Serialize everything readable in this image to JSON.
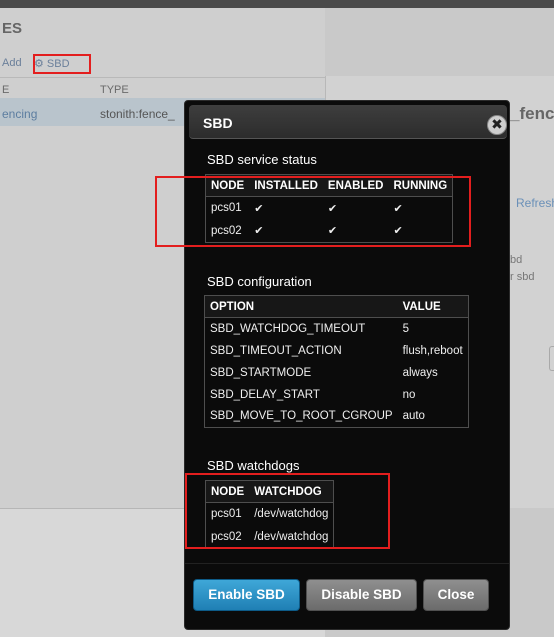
{
  "background": {
    "section_title": "ES",
    "add_label": "Add",
    "sbd_button_label": "⚙ SBD",
    "col_name": "E",
    "col_type": "TYPE",
    "row_name": "encing",
    "row_type": "stonith:fence_",
    "detail_title": "_fenc",
    "refresh_link": "Refresh",
    "detail_line1": "bd",
    "detail_line2": "r sbd"
  },
  "dialog": {
    "title": "SBD",
    "close_glyph": "✖",
    "status": {
      "title": "SBD service status",
      "headers": [
        "NODE",
        "INSTALLED",
        "ENABLED",
        "RUNNING"
      ],
      "rows": [
        {
          "node": "pcs01",
          "installed": "✔",
          "enabled": "✔",
          "running": "✔"
        },
        {
          "node": "pcs02",
          "installed": "✔",
          "enabled": "✔",
          "running": "✔"
        }
      ]
    },
    "config": {
      "title": "SBD configuration",
      "headers": [
        "OPTION",
        "VALUE"
      ],
      "rows": [
        {
          "option": "SBD_WATCHDOG_TIMEOUT",
          "value": "5"
        },
        {
          "option": "SBD_TIMEOUT_ACTION",
          "value": "flush,reboot"
        },
        {
          "option": "SBD_STARTMODE",
          "value": "always"
        },
        {
          "option": "SBD_DELAY_START",
          "value": "no"
        },
        {
          "option": "SBD_MOVE_TO_ROOT_CGROUP",
          "value": "auto"
        }
      ]
    },
    "watchdogs": {
      "title": "SBD watchdogs",
      "headers": [
        "NODE",
        "WATCHDOG"
      ],
      "rows": [
        {
          "node": "pcs01",
          "watchdog": "/dev/watchdog"
        },
        {
          "node": "pcs02",
          "watchdog": "/dev/watchdog"
        }
      ]
    },
    "buttons": {
      "enable": "Enable SBD",
      "disable": "Disable SBD",
      "close": "Close"
    }
  },
  "colors": {
    "highlight": "#e31e1e",
    "primary_button": "#2a8fc6",
    "dialog_bg": "#0b0b0b"
  }
}
